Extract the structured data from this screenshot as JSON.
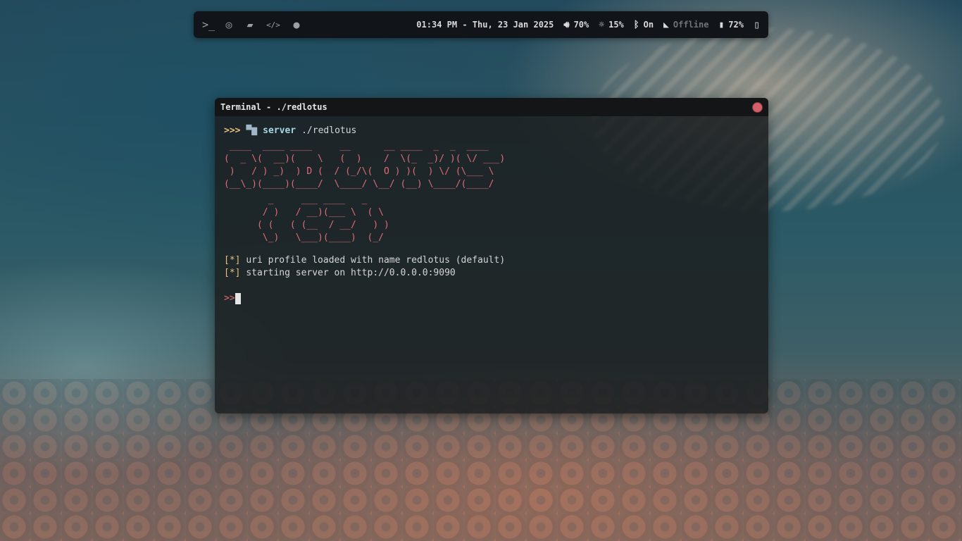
{
  "topbar": {
    "launchers": [
      {
        "icon": "terminal-icon",
        "glyph": ">_"
      },
      {
        "icon": "browser-icon",
        "glyph": "◎"
      },
      {
        "icon": "folder-icon",
        "glyph": "▰"
      },
      {
        "icon": "code-icon",
        "glyph": "</>"
      },
      {
        "icon": "chat-icon",
        "glyph": "●"
      }
    ],
    "datetime": "01:34 PM - Thu, 23 Jan 2025",
    "volume": "70%",
    "brightness": "15%",
    "bluetooth": "On",
    "network": "Offline",
    "battery": "72%"
  },
  "terminal": {
    "title": "Terminal - ./redlotus",
    "prompt_arrows": ">>>",
    "command": "server",
    "command_args": "./redlotus",
    "ascii_line1": " ____  ____ ____     __      __ ____  _  _  ____\n(  _ \\(  __)(    \\   (  )    /  \\(_  _)/ )( \\/ ___)\n )   / ) _)  ) D (  / (_/\\(  O ) )(  ) \\/ (\\___ \\\n(__\\_)(____)(____/  \\____/ \\__/ (__) \\____/(____/",
    "ascii_line2": "        _     ___ ____   _\n       / )   / __)(___ \\  ( \\\n      ( (   ( (__  / __/   ) )\n       \\_)   \\___)(____)  (_/",
    "log_tag": "[*]",
    "log1": "uri profile loaded with name redlotus (default)",
    "log2": "starting server on http://0.0.0.0:9090",
    "input_prompt": ">>"
  },
  "colors": {
    "accent_red": "#e06c75",
    "accent_yellow": "#e6c07b",
    "accent_green": "#98c379"
  }
}
